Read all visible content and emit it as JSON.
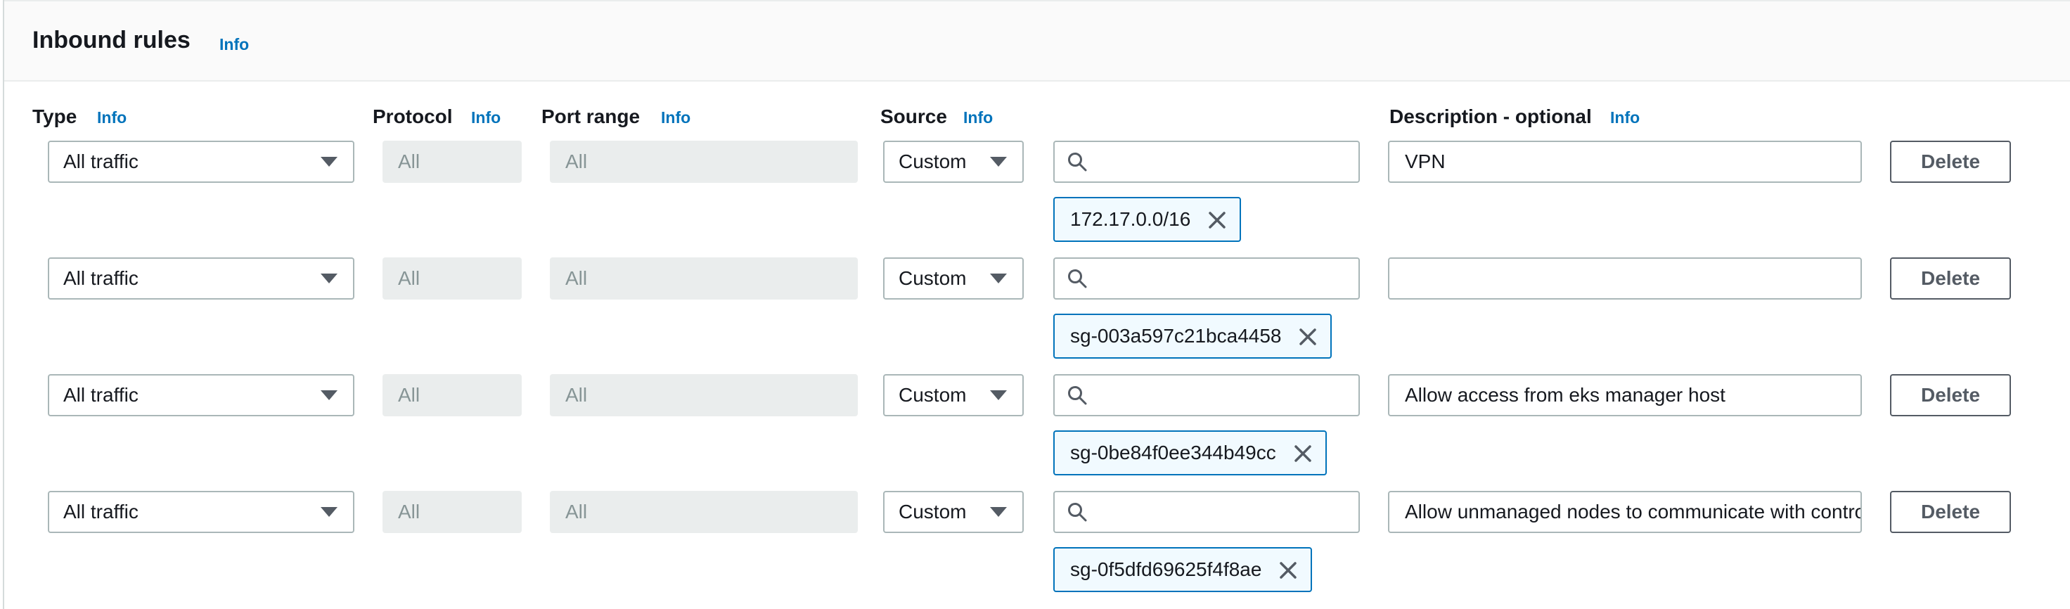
{
  "header": {
    "title": "Inbound rules",
    "info": "Info"
  },
  "columns": {
    "type": "Type",
    "protocol": "Protocol",
    "port_range": "Port range",
    "source": "Source",
    "description": "Description - optional",
    "info": "Info"
  },
  "rows": [
    {
      "type": "All traffic",
      "protocol": "All",
      "port_range": "All",
      "source_type": "Custom",
      "search_value": "",
      "token": "172.17.0.0/16",
      "description": "VPN",
      "delete": "Delete"
    },
    {
      "type": "All traffic",
      "protocol": "All",
      "port_range": "All",
      "source_type": "Custom",
      "search_value": "",
      "token": "sg-003a597c21bca4458",
      "description": "",
      "delete": "Delete"
    },
    {
      "type": "All traffic",
      "protocol": "All",
      "port_range": "All",
      "source_type": "Custom",
      "search_value": "",
      "token": "sg-0be84f0ee344b49cc",
      "description": "Allow access from eks manager host",
      "delete": "Delete"
    },
    {
      "type": "All traffic",
      "protocol": "All",
      "port_range": "All",
      "source_type": "Custom",
      "search_value": "",
      "token": "sg-0f5dfd69625f4f8ae",
      "description": "Allow unmanaged nodes to communicate with control plane (all ports)",
      "delete": "Delete"
    }
  ],
  "icons": {
    "search": "search-icon",
    "dropdown": "caret-down-icon",
    "remove": "close-icon"
  },
  "colors": {
    "link": "#0073bb",
    "token_border": "#0073bb",
    "token_bg": "#f1faff",
    "disabled_bg": "#eaeded"
  }
}
